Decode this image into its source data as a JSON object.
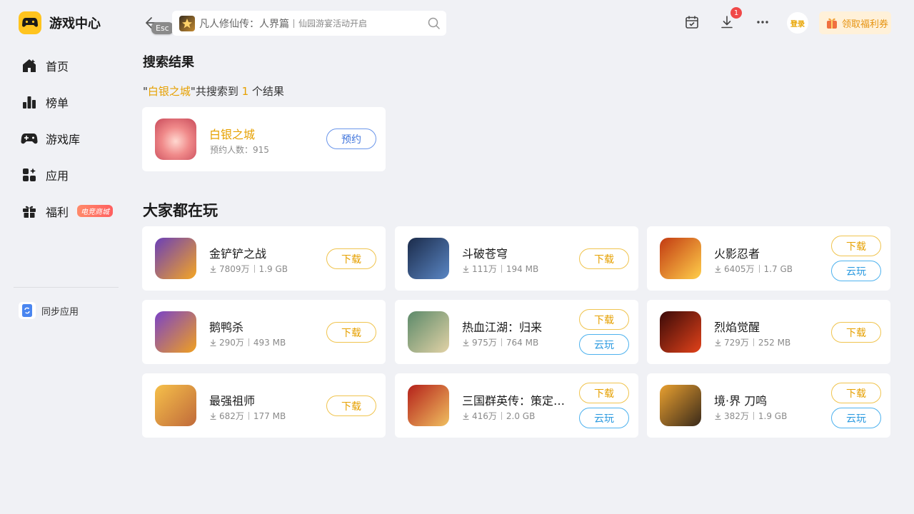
{
  "app": {
    "title": "游戏中心"
  },
  "nav": {
    "items": [
      {
        "label": "首页",
        "icon": "home-icon"
      },
      {
        "label": "榜单",
        "icon": "ranking-icon"
      },
      {
        "label": "游戏库",
        "icon": "gamepad-icon"
      },
      {
        "label": "应用",
        "icon": "apps-icon"
      },
      {
        "label": "福利",
        "icon": "gift-icon",
        "badge": "电竞商城"
      }
    ],
    "sync_label": "同步应用"
  },
  "topbar": {
    "esc_tip": "Esc",
    "search_value": "凡人修仙传：人界篇",
    "search_hint": "仙园游宴活动开启",
    "download_badge": "1",
    "login_label": "登录",
    "coupon_label": "领取福利券"
  },
  "search_results": {
    "heading": "搜索结果",
    "quote_open": "\"",
    "keyword": "白银之城",
    "mid_text": "\"共搜索到 ",
    "count": "1",
    "tail_text": " 个结果",
    "items": [
      {
        "name": "白银之城",
        "meta": "预约人数：915",
        "action": "预约"
      }
    ]
  },
  "popular": {
    "heading": "大家都在玩",
    "games": [
      {
        "name": "金铲铲之战",
        "downloads": "7809万",
        "size": "1.9 GB",
        "action": "下载",
        "cloud": "",
        "colors": [
          "#6a3fb8",
          "#f5a623"
        ]
      },
      {
        "name": "斗破苍穹",
        "downloads": "111万",
        "size": "194 MB",
        "action": "下载",
        "cloud": "",
        "colors": [
          "#1b2b4a",
          "#5a86c4"
        ]
      },
      {
        "name": "火影忍者",
        "downloads": "6405万",
        "size": "1.7 GB",
        "action": "下载",
        "cloud": "云玩",
        "colors": [
          "#c23a12",
          "#ffcf4a"
        ]
      },
      {
        "name": "鹅鸭杀",
        "downloads": "290万",
        "size": "493 MB",
        "action": "下载",
        "cloud": "",
        "colors": [
          "#7a43c7",
          "#f0a020"
        ]
      },
      {
        "name": "热血江湖：归来",
        "downloads": "975万",
        "size": "764 MB",
        "action": "下载",
        "cloud": "云玩",
        "colors": [
          "#5c8a6a",
          "#e2d2a6"
        ]
      },
      {
        "name": "烈焰觉醒",
        "downloads": "729万",
        "size": "252 MB",
        "action": "下载",
        "cloud": "",
        "colors": [
          "#3a0a08",
          "#e2421a"
        ]
      },
      {
        "name": "最强祖师",
        "downloads": "682万",
        "size": "177 MB",
        "action": "下载",
        "cloud": "",
        "colors": [
          "#f6c04a",
          "#c06a3a"
        ]
      },
      {
        "name": "三国群英传：策定九州",
        "downloads": "416万",
        "size": "2.0 GB",
        "action": "下载",
        "cloud": "云玩",
        "colors": [
          "#b4201a",
          "#f0c060"
        ]
      },
      {
        "name": "境·界 刀鸣",
        "downloads": "382万",
        "size": "1.9 GB",
        "action": "下载",
        "cloud": "云玩",
        "colors": [
          "#e9a030",
          "#3a2a1a"
        ]
      }
    ]
  },
  "colors": {
    "accent": "#e6a000",
    "brand": "#ffc41f",
    "cloud": "#2d9be0",
    "book": "#3f74dc",
    "badge": "#f04848"
  }
}
